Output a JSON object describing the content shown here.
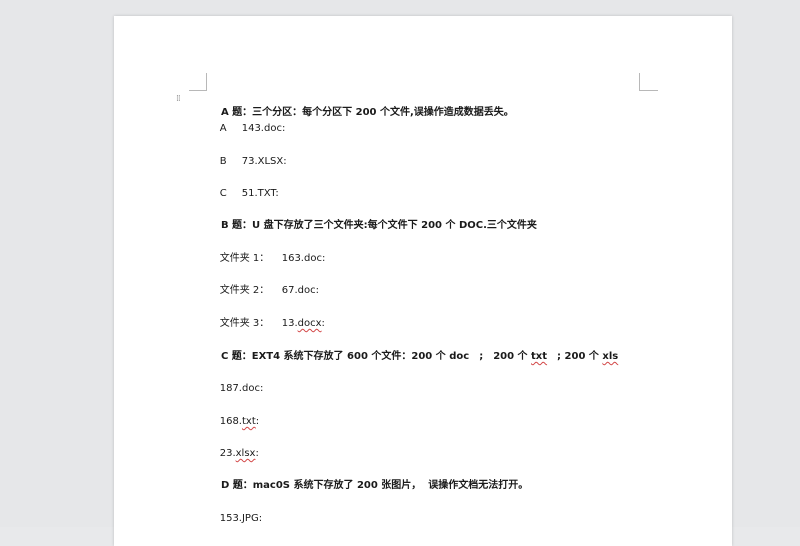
{
  "document": {
    "lines": [
      {
        "id": "qa-title",
        "text": "A 题：三个分区：每个分区下 200 个文件,误操作造成数据丢失。",
        "bold": true
      },
      {
        "id": "qa-a",
        "label": "A",
        "value": "143.doc:"
      },
      {
        "id": "qa-b",
        "label": "B",
        "value": "73.XLSX:"
      },
      {
        "id": "qa-c",
        "label": "C",
        "value": "51.TXT:"
      },
      {
        "id": "qb-title",
        "text": "B 题：U 盘下存放了三个文件夹:每个文件下 200 个 DOC.三个文件夹",
        "bold": true
      },
      {
        "id": "qb-1",
        "label": "文件夹 1：",
        "value": "163.doc:"
      },
      {
        "id": "qb-2",
        "label": "文件夹 2：",
        "value": "67.doc:"
      },
      {
        "id": "qb-3",
        "label": "文件夹 3：",
        "value_prefix": "13.",
        "value_squiggle": "docx",
        "value_suffix": ":"
      },
      {
        "id": "qc-title",
        "prefix": "C 题：EXT4 系统下存放了 600 个文件：200 个 doc　;　200 个 ",
        "sq1": "txt",
        "mid": "　; 200 个 ",
        "sq2": "xls",
        "bold": true
      },
      {
        "id": "qc-1",
        "text": "187.doc:"
      },
      {
        "id": "qc-2",
        "prefix": "168.",
        "squiggle": "txt",
        "suffix": ":"
      },
      {
        "id": "qc-3",
        "prefix": "23.",
        "squiggle": "xlsx",
        "suffix": ":"
      },
      {
        "id": "qd-title",
        "text": "D 题：mac0S 系统下存放了 200 张图片，  误操作文档无法打开。",
        "bold": true
      },
      {
        "id": "qd-1",
        "text": "153.JPG:"
      }
    ]
  },
  "icons": {
    "move_handle": "drag-handle-icon"
  }
}
